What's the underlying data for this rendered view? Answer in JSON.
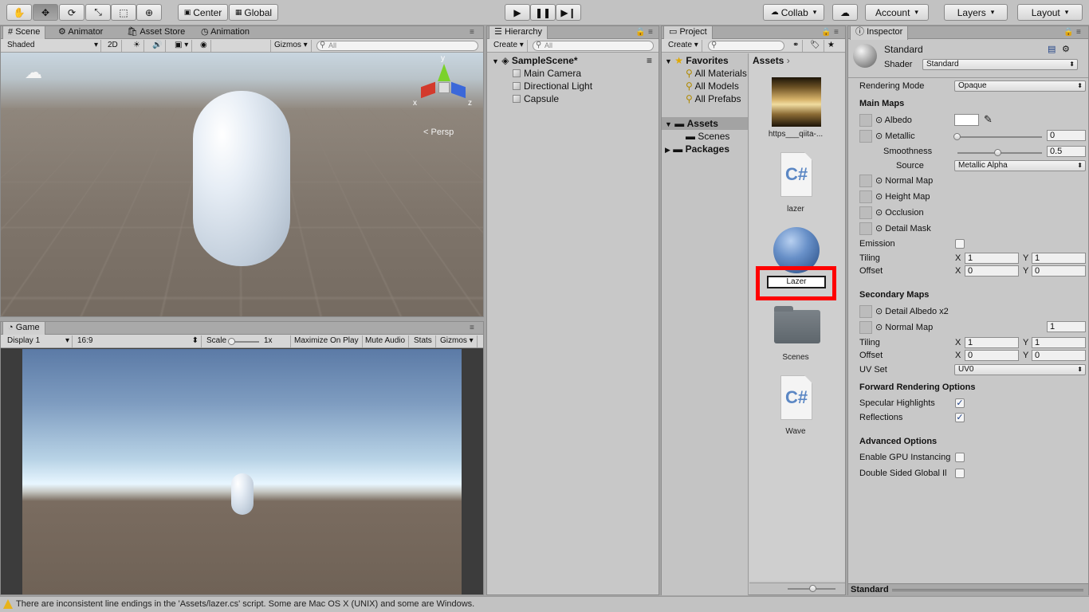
{
  "toolbar": {
    "pivot_label": "Center",
    "space_label": "Global",
    "collab_label": "Collab",
    "account_label": "Account",
    "layers_label": "Layers",
    "layout_label": "Layout"
  },
  "scene": {
    "tabs": [
      "Scene",
      "Animator",
      "Asset Store",
      "Animation"
    ],
    "draw_mode": "Shaded",
    "mode_2d": "2D",
    "gizmos": "Gizmos",
    "search_placeholder": "All",
    "persp_label": "Persp",
    "axis_x": "x",
    "axis_y": "y",
    "axis_z": "z"
  },
  "game": {
    "tab": "Game",
    "display": "Display 1",
    "aspect": "16:9",
    "scale_label": "Scale",
    "scale_value": "1x",
    "maximize": "Maximize On Play",
    "mute": "Mute Audio",
    "stats": "Stats",
    "gizmos": "Gizmos"
  },
  "hierarchy": {
    "tab": "Hierarchy",
    "create": "Create",
    "search_placeholder": "All",
    "scene_name": "SampleScene*",
    "items": [
      "Main Camera",
      "Directional Light",
      "Capsule"
    ]
  },
  "project": {
    "tab": "Project",
    "create": "Create",
    "favorites_label": "Favorites",
    "favorites": [
      "All Materials",
      "All Models",
      "All Prefabs"
    ],
    "assets_label": "Assets",
    "assets_children": [
      "Scenes"
    ],
    "packages_label": "Packages",
    "breadcrumb": "Assets",
    "assets": {
      "texture": "https___qiita-...",
      "script1": "lazer",
      "material_rename": "Lazer",
      "folder": "Scenes",
      "script2": "Wave",
      "cs_glyph": "C#"
    }
  },
  "inspector": {
    "tab": "Inspector",
    "material_name": "Standard",
    "shader_label": "Shader",
    "shader_value": "Standard",
    "rendering_mode_label": "Rendering Mode",
    "rendering_mode_value": "Opaque",
    "main_maps": "Main Maps",
    "albedo": "Albedo",
    "metallic": "Metallic",
    "metallic_value": "0",
    "smoothness": "Smoothness",
    "smoothness_value": "0.5",
    "source": "Source",
    "source_value": "Metallic Alpha",
    "normal_map": "Normal Map",
    "height_map": "Height Map",
    "occlusion": "Occlusion",
    "detail_mask": "Detail Mask",
    "emission": "Emission",
    "tiling": "Tiling",
    "offset": "Offset",
    "x_label": "X",
    "y_label": "Y",
    "tiling_x": "1",
    "tiling_y": "1",
    "offset_x": "0",
    "offset_y": "0",
    "secondary_maps": "Secondary Maps",
    "detail_albedo": "Detail Albedo x2",
    "sec_normal_map": "Normal Map",
    "sec_normal_value": "1",
    "sec_tiling_x": "1",
    "sec_tiling_y": "1",
    "sec_offset_x": "0",
    "sec_offset_y": "0",
    "uv_set": "UV Set",
    "uv_set_value": "UV0",
    "forward_rendering": "Forward Rendering Options",
    "specular_highlights": "Specular Highlights",
    "reflections": "Reflections",
    "advanced_options": "Advanced Options",
    "gpu_instancing": "Enable GPU Instancing",
    "double_sided": "Double Sided Global Il",
    "preview_label": "Standard"
  },
  "status": {
    "message": "There are inconsistent line endings in the 'Assets/lazer.cs' script. Some are Mac OS X (UNIX) and some are Windows."
  },
  "colors": {
    "highlight_red": "#ff0000",
    "accent_blue": "#1d3f85"
  }
}
